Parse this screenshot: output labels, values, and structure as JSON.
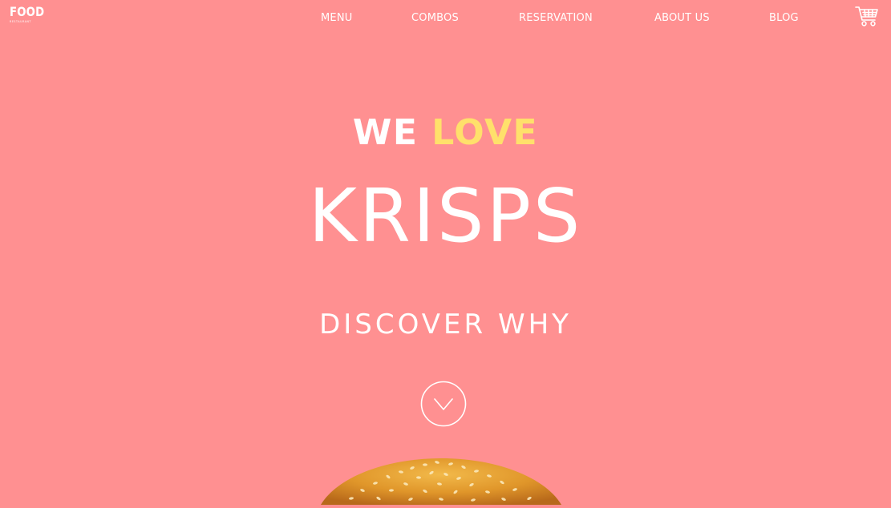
{
  "logo": {
    "main": "FOOD",
    "sub": "RESTAURANT"
  },
  "nav": {
    "items": [
      {
        "label": "MENU"
      },
      {
        "label": "COMBOS"
      },
      {
        "label": "RESERVATION"
      },
      {
        "label": "ABOUT US"
      },
      {
        "label": "BLOG"
      }
    ]
  },
  "cart": {
    "icon": "cart-icon"
  },
  "hero": {
    "tagline_we": "WE",
    "tagline_love": "LOVE",
    "brand": "KRISPS",
    "cta": "DISCOVER WHY",
    "scroll_icon": "chevron-down-circle-icon",
    "image": "burger-bun"
  },
  "colors": {
    "background": "#ff9091",
    "accent_yellow": "#ffe06b",
    "text": "#ffffff"
  }
}
